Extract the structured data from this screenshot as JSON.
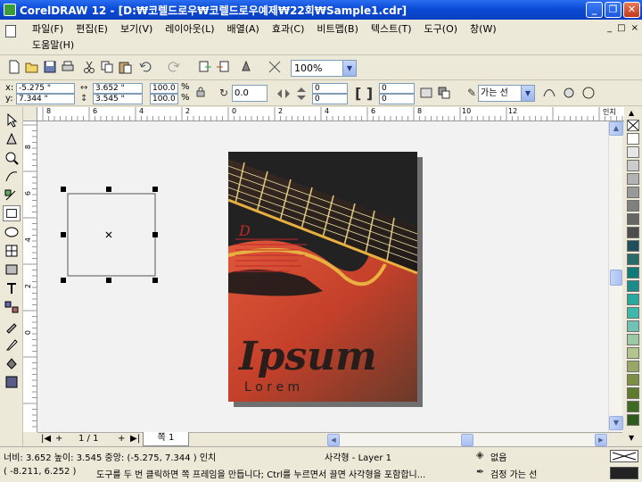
{
  "window": {
    "title": "CorelDRAW 12 - [D:₩코렐드로우₩코렐드로우예제₩22회₩Sample1.cdr]",
    "minimize": "_",
    "maximize": "❐",
    "close": "✕"
  },
  "menu": {
    "items": [
      "파일(F)",
      "편집(E)",
      "보기(V)",
      "레이아웃(L)",
      "배열(A)",
      "효과(C)",
      "비트맵(B)",
      "텍스트(T)",
      "도구(O)",
      "창(W)"
    ],
    "help": "도움말(H)",
    "mdi": [
      "_",
      "□",
      "×"
    ]
  },
  "toolbar": {
    "zoom": "100%",
    "icons": [
      "new-icon",
      "open-icon",
      "save-icon",
      "print-icon",
      "cut-icon",
      "copy-icon",
      "paste-icon",
      "undo-icon",
      "redo-icon",
      "import-icon",
      "export-icon",
      "app-launcher-icon",
      "welcome-icon"
    ]
  },
  "propbar": {
    "x_label": "x:",
    "y_label": "y:",
    "x_value": "-5.275 \"",
    "y_value": "7.344 \"",
    "w_value": "3.652 \"",
    "h_value": "3.545 \"",
    "scale_x": "100.0",
    "scale_y": "100.0",
    "pct": "%",
    "rotation": "0.0",
    "corner_tl": "0",
    "corner_bl": "0",
    "corner_tr": "0",
    "corner_br": "0",
    "outline_width": "가는 선"
  },
  "rulers": {
    "h_labels": [
      "8",
      "6",
      "4",
      "2",
      "0",
      "2",
      "4",
      "6",
      "8",
      "10",
      "12",
      "인치"
    ],
    "v_labels": [
      "8",
      "6",
      "4",
      "2",
      "0"
    ]
  },
  "artwork": {
    "script_text": "Ipsum",
    "serif_text": "L o r e m",
    "logo_letter": "D"
  },
  "palette": {
    "colors": [
      "#ffffff",
      "#e6e6e6",
      "#cccccc",
      "#b3b3b3",
      "#999999",
      "#808080",
      "#666666",
      "#4d4d4d",
      "#1f4f5a",
      "#2a6a6a",
      "#0f7a78",
      "#1c8c8a",
      "#2aa79f",
      "#3fb8ac",
      "#6fc2b5",
      "#9cc9a5",
      "#b2c58c",
      "#9aa867",
      "#7c8f44",
      "#5e7a2d",
      "#3f6a21",
      "#2e5a1c"
    ]
  },
  "pagebar": {
    "page_count": "1 / 1",
    "page_tab": "쪽 1"
  },
  "status": {
    "dims": "너비: 3.652  높이: 3.545  중앙: (-5.275, 7.344 )  인치",
    "object": "사각형 - Layer 1",
    "fill": "없음",
    "cursor": "( -8.211, 6.252 )",
    "hint": "도구를 두 번 클릭하면 쪽 프레임을 만듭니다; Ctrl를 누르면서 끌면 사각형을 포함합니...",
    "outline": "검정  가는 선"
  }
}
